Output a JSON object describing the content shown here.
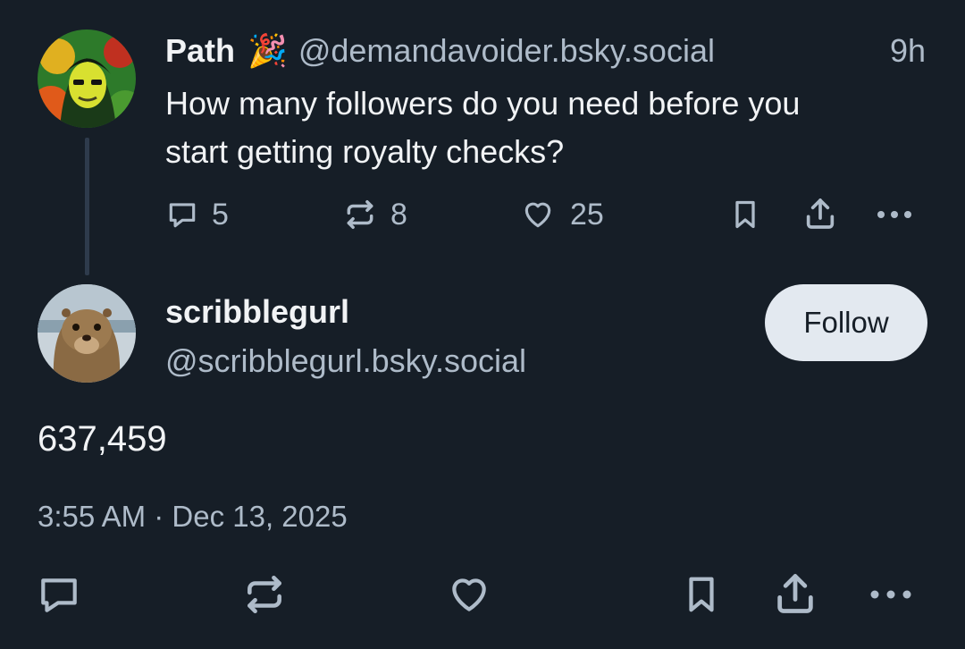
{
  "parent_post": {
    "author_name": "Path",
    "author_emoji": "🎉",
    "author_handle": "@demandavoider.bsky.social",
    "time_ago": "9h",
    "text_line1": "How many followers do you need before you",
    "text_line2": "start getting royalty checks?",
    "reply_count": "5",
    "repost_count": "8",
    "like_count": "25",
    "icons": [
      "reply-icon",
      "repost-icon",
      "like-icon",
      "bookmark-icon",
      "share-icon",
      "more-icon"
    ]
  },
  "main_post": {
    "author_name": "scribblegurl",
    "author_handle": "@scribblegurl.bsky.social",
    "follow_label": "Follow",
    "text": "637,459",
    "timestamp": "3:55 AM · Dec 13, 2025",
    "icons": [
      "reply-icon",
      "repost-icon",
      "like-icon",
      "bookmark-icon",
      "share-icon",
      "more-icon"
    ]
  },
  "colors": {
    "background": "#161e27",
    "text": "#f1f3f5",
    "muted": "#aebbc9",
    "thread_line": "#2e3b4c",
    "follow_button": "#e3e9f0"
  }
}
